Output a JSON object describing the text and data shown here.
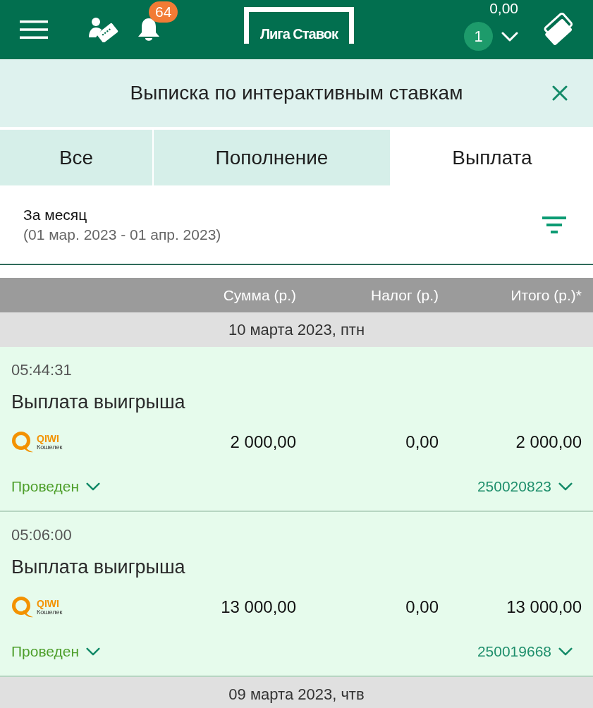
{
  "header": {
    "logo": "Лига Ставок",
    "notifications": "64",
    "balance": "0,00",
    "coupons": "1"
  },
  "statement": {
    "title": "Выписка по интерактивным ставкам"
  },
  "tabs": [
    {
      "label": "Все",
      "selected": false
    },
    {
      "label": "Пополнение",
      "selected": false
    },
    {
      "label": "Выплата",
      "selected": true
    }
  ],
  "period": {
    "label": "За месяц",
    "range": "(01 мар. 2023 - 01 апр. 2023)"
  },
  "table": {
    "columns": [
      "Сумма (р.)",
      "Налог (р.)",
      "Итого (р.)*"
    ],
    "groups": [
      {
        "date": "10 марта 2023, птн",
        "rows": [
          {
            "time": "05:44:31",
            "title": "Выплата выигрыша",
            "method": {
              "name": "QIWI",
              "caption": "Кошелек"
            },
            "amount": "2 000,00",
            "tax": "0,00",
            "total": "2 000,00",
            "status": "Проведен",
            "id": "250020823"
          },
          {
            "time": "05:06:00",
            "title": "Выплата выигрыша",
            "method": {
              "name": "QIWI",
              "caption": "Кошелек"
            },
            "amount": "13 000,00",
            "tax": "0,00",
            "total": "13 000,00",
            "status": "Проведен",
            "id": "250019668"
          }
        ]
      },
      {
        "date": "09 марта 2023, чтв"
      }
    ]
  }
}
